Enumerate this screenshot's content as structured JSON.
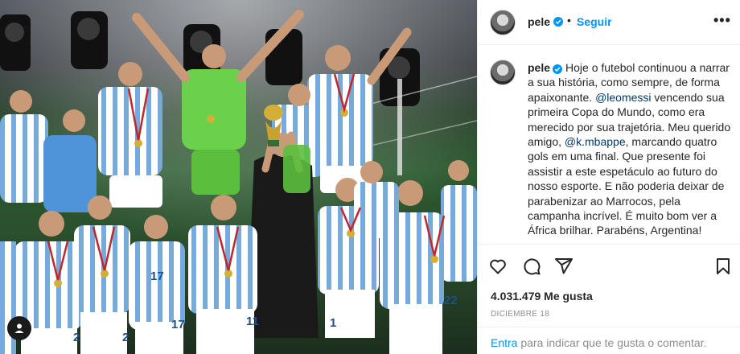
{
  "post": {
    "photo_alt": "",
    "shirt_numbers": [
      "17",
      "17",
      "11",
      "22",
      "2",
      "2",
      "1"
    ]
  },
  "header": {
    "username": "pele",
    "dot": "•",
    "follow_label": "Seguir",
    "more_label": "•••"
  },
  "caption": {
    "username": "pele",
    "parts": [
      {
        "type": "text",
        "value": "Hoje o futebol continuou a narrar a sua história, como sempre, de forma apaixonante. "
      },
      {
        "type": "mention",
        "value": "@leomessi"
      },
      {
        "type": "text",
        "value": " vencendo sua primeira Copa do Mundo, como era merecido por sua trajetória. Meu querido amigo, "
      },
      {
        "type": "mention",
        "value": "@k.mbappe"
      },
      {
        "type": "text",
        "value": ", marcando quatro gols em uma final. Que presente foi assistir a este espetáculo ao futuro do nosso esporte. E não poderia deixar de parabenizar ao Marrocos, pela campanha incrível. É muito bom ver a África brilhar. Parabéns, Argentina!"
      }
    ]
  },
  "stats": {
    "likes": "4.031.479 Me gusta",
    "date": "DICIEMBRE 18"
  },
  "comment": {
    "login_link": "Entra",
    "login_rest": " para indicar que te gusta o comentar."
  },
  "colors": {
    "accent": "#0095f6",
    "mention": "#00376b",
    "muted": "#8e8e8e",
    "border": "#efefef",
    "jersey_blue": "#75aadb",
    "keeper_green": "#6ad14a",
    "trophy_gold": "#d4af37"
  },
  "icons": {
    "verified": "verified-badge-icon",
    "like": "heart-icon",
    "comment": "comment-bubble-icon",
    "share": "paper-plane-icon",
    "save": "bookmark-icon",
    "user_tag": "user-tag-icon"
  }
}
